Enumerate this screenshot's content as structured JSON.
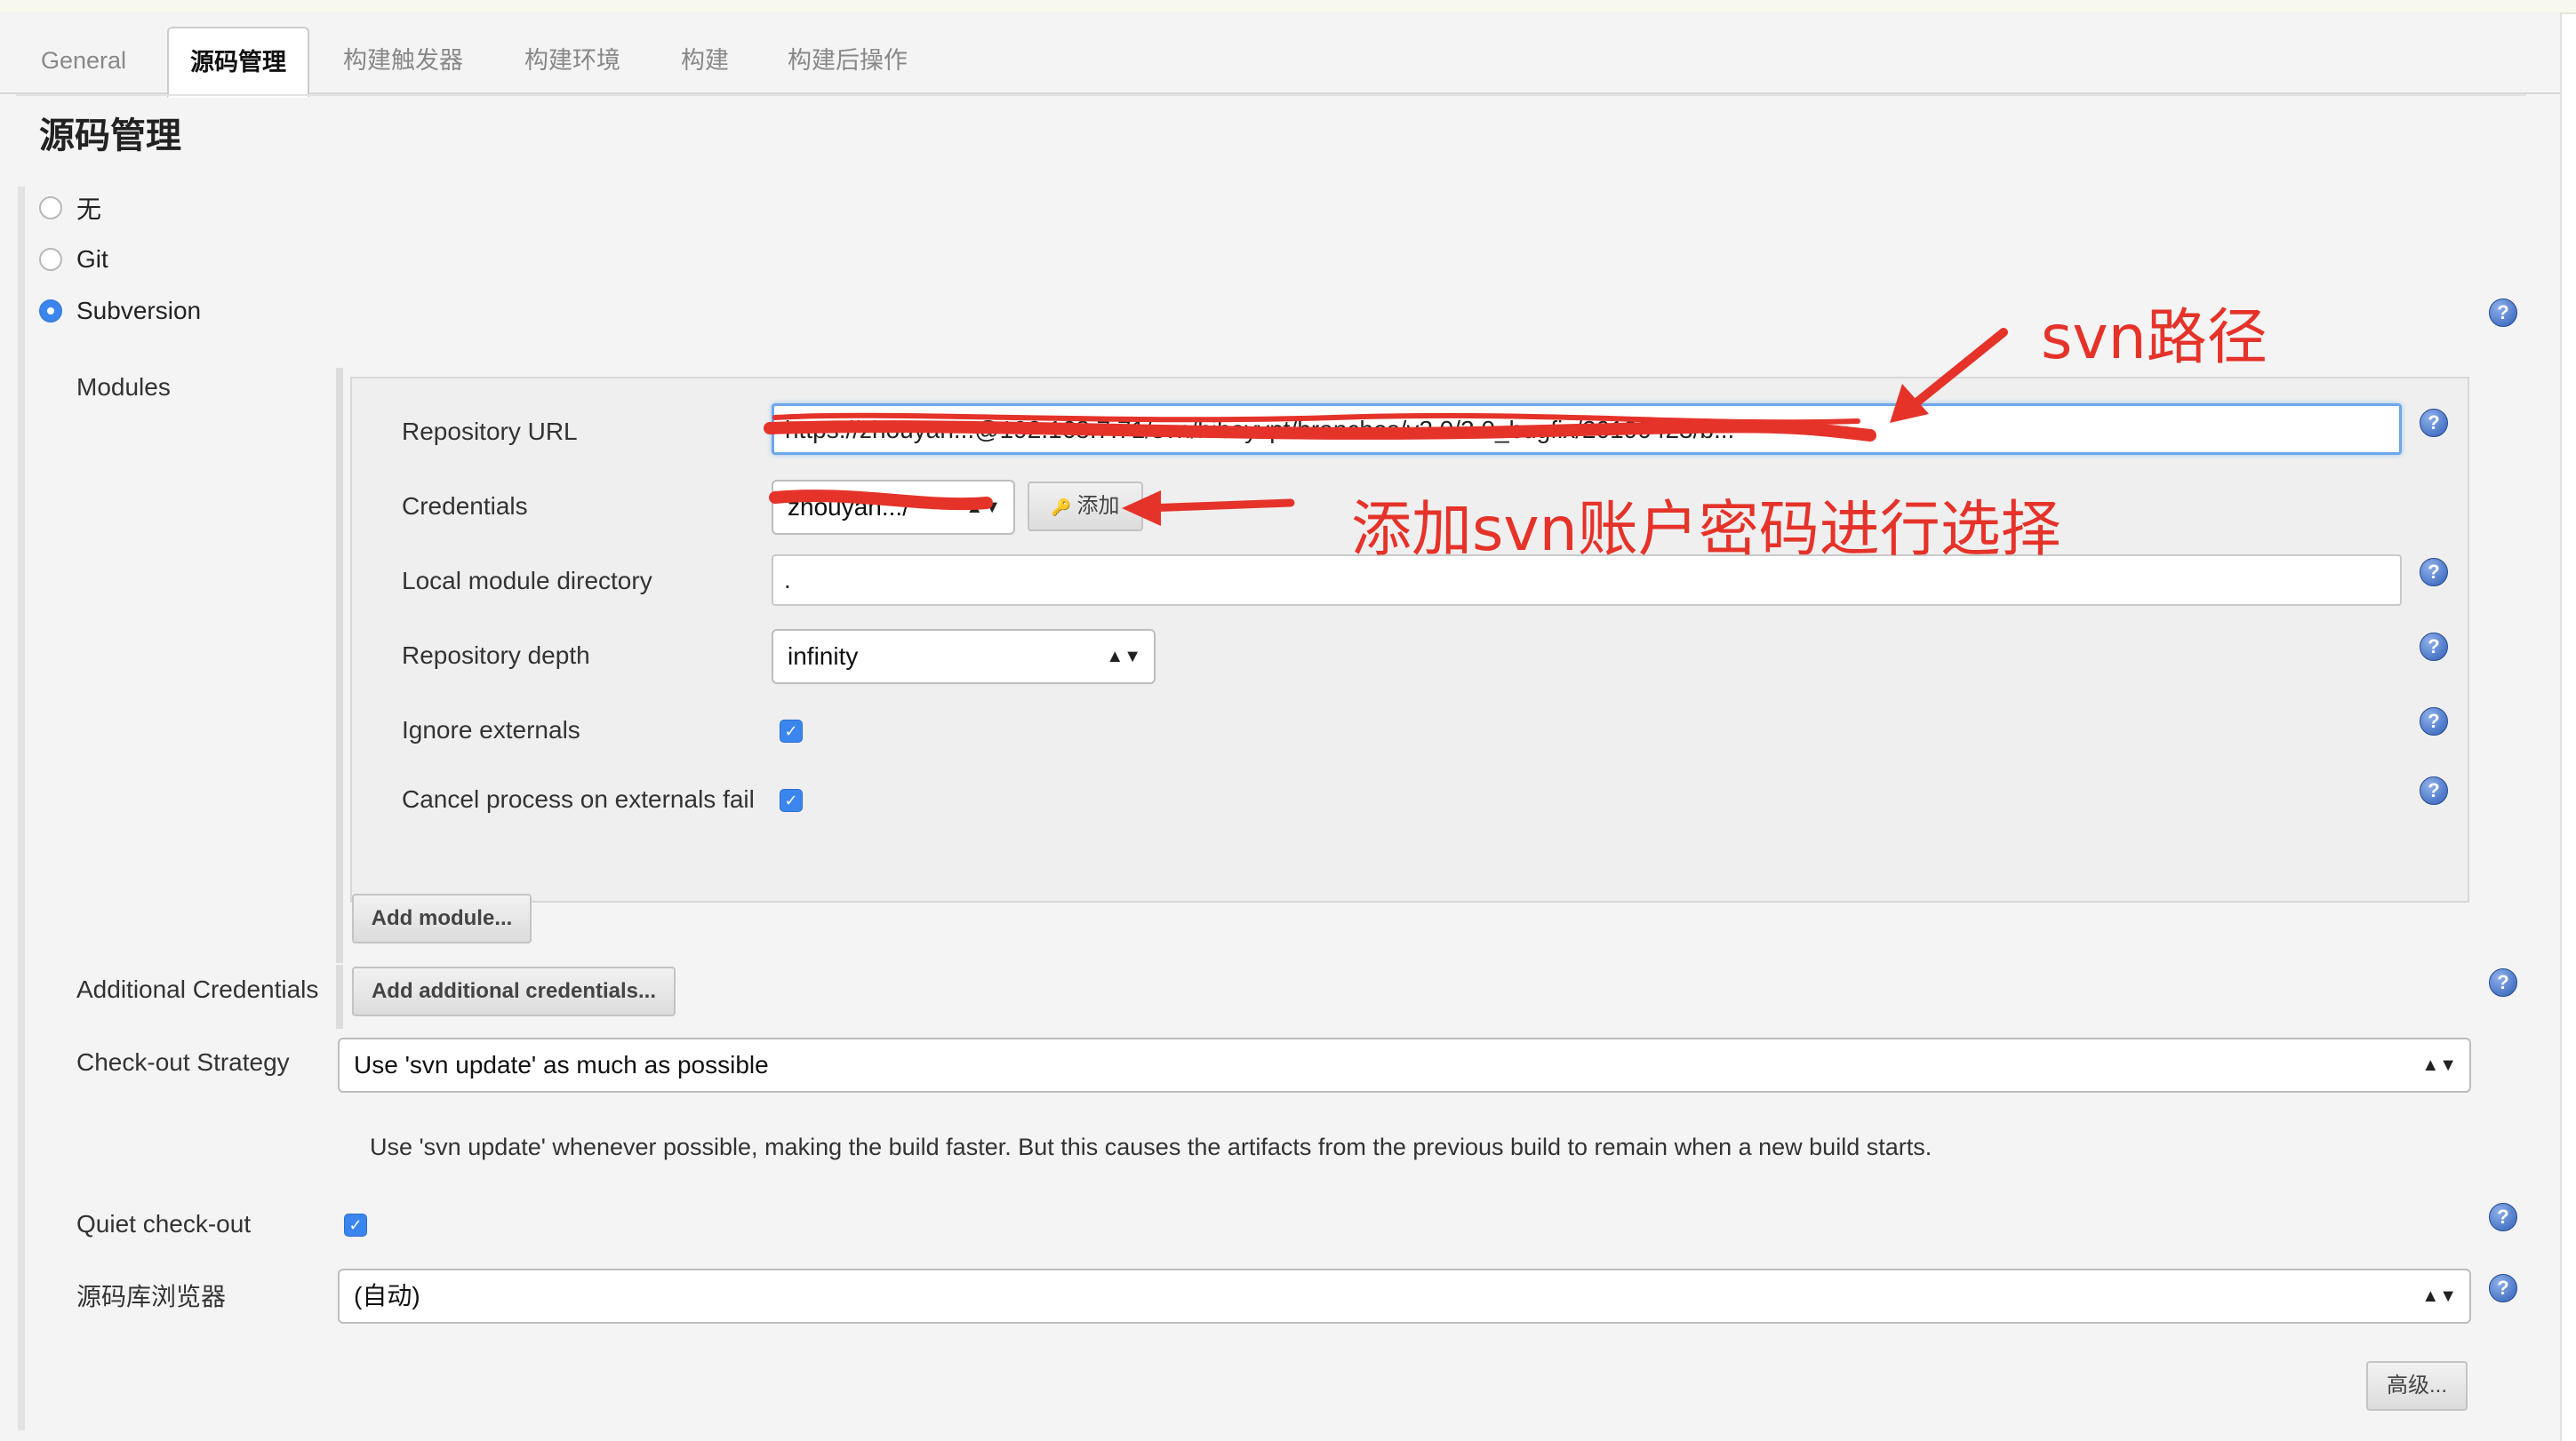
{
  "tabs": [
    {
      "label": "General"
    },
    {
      "label": "源码管理"
    },
    {
      "label": "构建触发器"
    },
    {
      "label": "构建环境"
    },
    {
      "label": "构建"
    },
    {
      "label": "构建后操作"
    }
  ],
  "section_title": "源码管理",
  "scm_options": [
    {
      "label": "无",
      "selected": false
    },
    {
      "label": "Git",
      "selected": false
    },
    {
      "label": "Subversion",
      "selected": true
    }
  ],
  "modules": {
    "label": "Modules",
    "repository_url": {
      "label": "Repository URL",
      "value": "https://zhouyan...@192.168.7.71/svn/hibayvpt/branches/v2.0/2.0_bugfix/20190423/b..."
    },
    "credentials": {
      "label": "Credentials",
      "value": "zhouyan.../******",
      "add_button": "添加"
    },
    "local_module_directory": {
      "label": "Local module directory",
      "value": "."
    },
    "repository_depth": {
      "label": "Repository depth",
      "value": "infinity"
    },
    "ignore_externals": {
      "label": "Ignore externals",
      "checked": true
    },
    "cancel_process": {
      "label": "Cancel process on externals fail",
      "checked": true
    },
    "add_module_button": "Add module..."
  },
  "additional_credentials": {
    "label": "Additional Credentials",
    "button": "Add additional credentials..."
  },
  "checkout_strategy": {
    "label": "Check-out Strategy",
    "value": "Use 'svn update' as much as possible",
    "description": "Use 'svn update' whenever possible, making the build faster. But this causes the artifacts from the previous build to remain when a new build starts."
  },
  "quiet_checkout": {
    "label": "Quiet check-out",
    "checked": true
  },
  "repo_browser": {
    "label": "源码库浏览器",
    "value": "(自动)"
  },
  "advanced_button": "高级...",
  "annotations": {
    "svn_path": "svn路径",
    "add_account": "添加svn账户密码进行选择",
    "color": "#e5332a"
  },
  "help_icon": "?",
  "check_icon": "✓",
  "key_icon": "🔑",
  "select_arrows": "▲▼"
}
